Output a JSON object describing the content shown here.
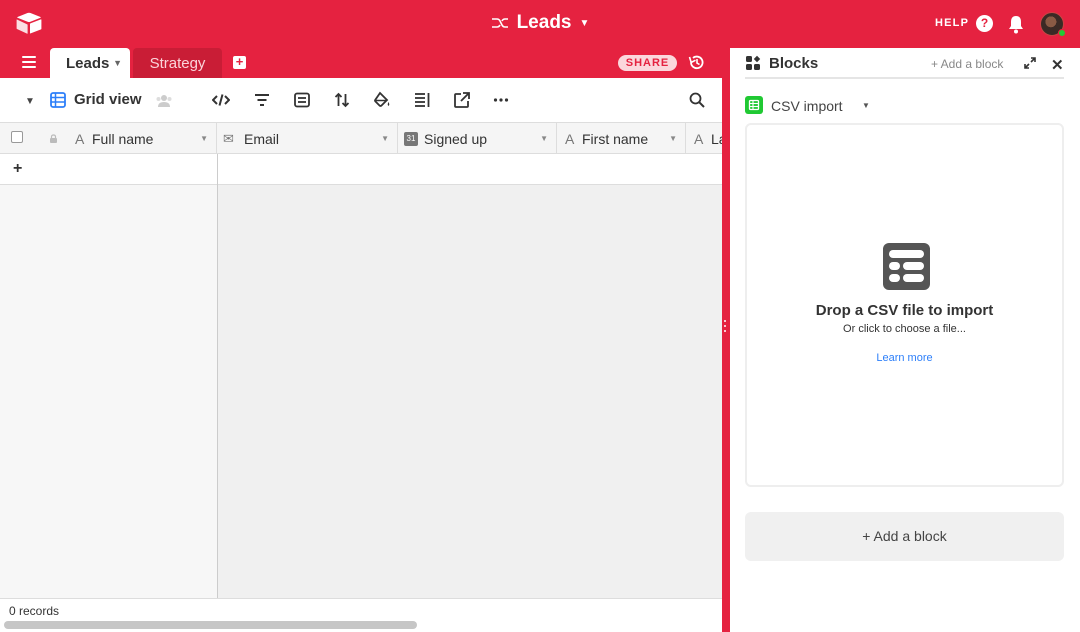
{
  "topbar": {
    "base_title": "Leads",
    "help_label": "HELP",
    "help_glyph": "?"
  },
  "tabs": {
    "active": "Leads",
    "other": "Strategy",
    "share_label": "SHARE"
  },
  "view": {
    "name": "Grid view",
    "toolbar_icons": [
      "code-icon",
      "filter-icon",
      "group-icon",
      "sort-icon",
      "paint-bucket-icon",
      "row-height-icon",
      "share-view-icon",
      "more-icon"
    ]
  },
  "columns": [
    {
      "name": "Full name",
      "icon": "text-field-icon",
      "glyph": "A"
    },
    {
      "name": "Email",
      "icon": "email-field-icon",
      "glyph": "✉"
    },
    {
      "name": "Signed up",
      "icon": "date-field-icon",
      "glyph": "31"
    },
    {
      "name": "First name",
      "icon": "text-field-icon",
      "glyph": "A"
    },
    {
      "name": "La",
      "icon": "text-field-icon",
      "glyph": "A"
    }
  ],
  "footer": {
    "records": "0 records"
  },
  "blocks": {
    "title": "Blocks",
    "add_block_small": "+ Add a block",
    "selected_block": "CSV import",
    "drop_title": "Drop a CSV file to import",
    "drop_subtitle": "Or click to choose a file...",
    "learn_more": "Learn more",
    "add_block_big": "+ Add a block"
  },
  "colors": {
    "brand": "#e52240",
    "accent_blue": "#2d7ff9",
    "csv_green": "#20c933"
  }
}
